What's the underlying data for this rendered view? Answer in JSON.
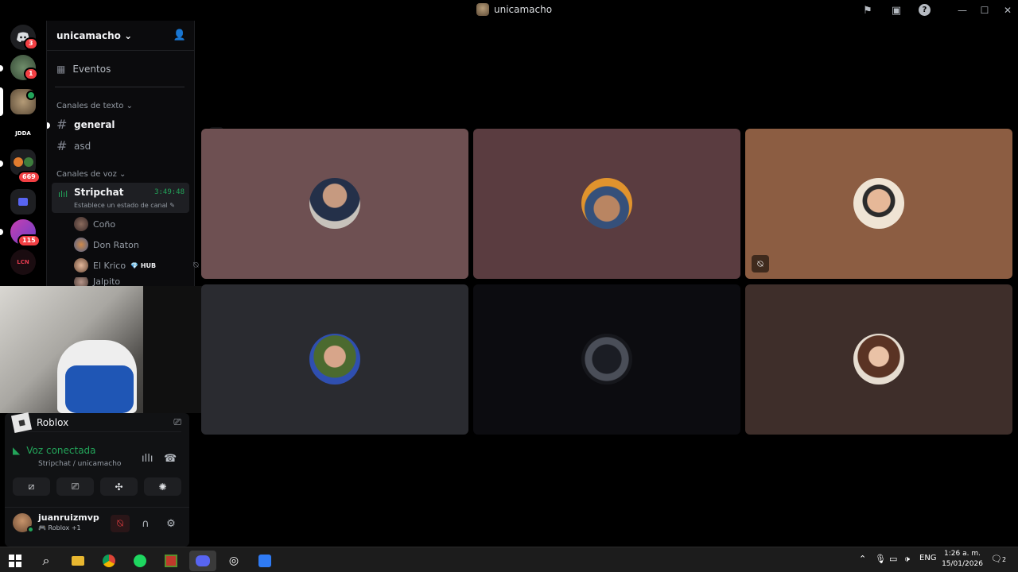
{
  "window": {
    "title": "unicamacho"
  },
  "rail": {
    "badges": [
      "3",
      "1",
      "669",
      "115"
    ],
    "server_labels": {
      "jdda": "JDDA",
      "lcn": "LCN"
    }
  },
  "sidebar": {
    "guild_name": "unicamacho",
    "events_label": "Eventos",
    "text_category": "Canales de texto",
    "text_channels": [
      "general",
      "asd"
    ],
    "voice_category": "Canales de voz",
    "voice_channel": {
      "name": "Stripchat",
      "duration": "3:49:48",
      "status": "Establece un estado de canal"
    },
    "members": [
      {
        "name": "Coño"
      },
      {
        "name": "Don Raton"
      },
      {
        "name": "El Krico",
        "tag": "HUB"
      },
      {
        "name": "Jalpito"
      }
    ]
  },
  "panel": {
    "activity_title": "Roblox",
    "voice_status": "Voz conectada",
    "voice_location": "Stripchat / unicamacho",
    "username": "juanruizmvp",
    "user_status": "Roblox +1"
  },
  "taskbar": {
    "language": "ENG",
    "time": "1:26 a. m.",
    "date": "15/01/2026",
    "notifications": "2"
  },
  "colors": {
    "speaking_green": "#23a55a",
    "badge_red": "#f23f43",
    "tile_1": "#6e5052",
    "tile_2": "#5a3c40",
    "tile_3": "#8c5d42",
    "tile_4": "#2a2b30",
    "tile_5": "#0c0c10",
    "tile_6": "#3e2e2a"
  }
}
